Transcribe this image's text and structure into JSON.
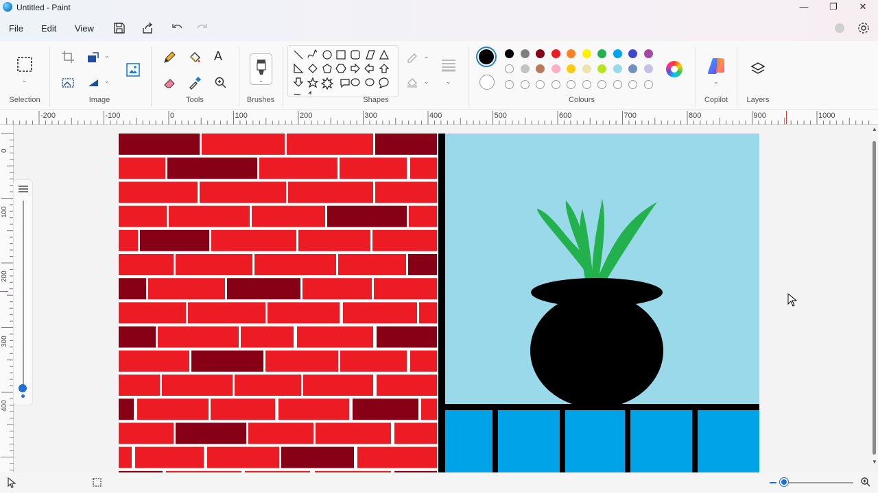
{
  "window": {
    "title": "Untitled - Paint"
  },
  "menu": {
    "file": "File",
    "edit": "Edit",
    "view": "View"
  },
  "ribbon": {
    "groups": {
      "selection": "Selection",
      "image": "Image",
      "tools": "Tools",
      "brushes": "Brushes",
      "shapes": "Shapes",
      "colours": "Colours",
      "copilot": "Copilot",
      "layers": "Layers"
    },
    "colours": {
      "primary": "#000000",
      "secondary": "#ffffff",
      "row1": [
        "#000000",
        "#7f7f7f",
        "#880015",
        "#ed1c24",
        "#ff7f27",
        "#fff200",
        "#22b14c",
        "#00a2e8",
        "#3f48cc",
        "#a349a4"
      ],
      "row2": [
        "#ffffff",
        "#c3c3c3",
        "#b97a57",
        "#ffaec9",
        "#ffc90e",
        "#efe4b0",
        "#b5e61d",
        "#99d9ea",
        "#7092be",
        "#c8bfe7"
      ]
    }
  },
  "ruler": {
    "horizontal_labels": [
      "-200",
      "-100",
      "0",
      "100",
      "200",
      "300",
      "400",
      "500",
      "600",
      "700",
      "800",
      "900",
      "1000"
    ],
    "vertical_labels": [
      "0",
      "100",
      "200",
      "300",
      "400",
      "500"
    ]
  },
  "canvas": {
    "brick_red": "#ed1c24",
    "brick_dark": "#880015",
    "mortar": "#ffffff",
    "sky": "#99d9ea",
    "railing": "#00a2e8",
    "pot": "#000000",
    "leaves": "#22b14c"
  }
}
